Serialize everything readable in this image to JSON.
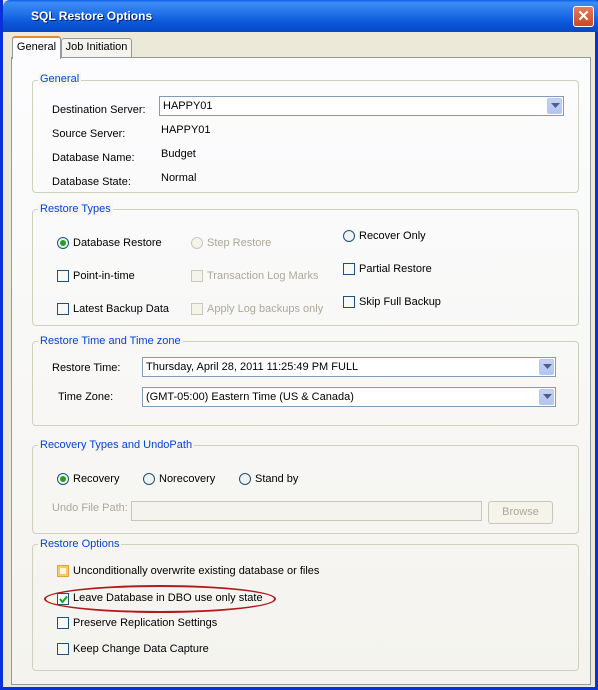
{
  "window": {
    "title": "SQL Restore Options"
  },
  "tabs": [
    {
      "label": "General"
    },
    {
      "label": "Job Initiation"
    }
  ],
  "general": {
    "legend": "General",
    "destination_label": "Destination Server:",
    "destination_value": "HAPPY01",
    "source_label": "Source Server:",
    "source_value": "HAPPY01",
    "dbname_label": "Database Name:",
    "dbname_value": "Budget",
    "dbstate_label": "Database State:",
    "dbstate_value": "Normal"
  },
  "restore_types": {
    "legend": "Restore Types",
    "database_restore": "Database Restore",
    "step_restore": "Step Restore",
    "recover_only": "Recover Only",
    "point_in_time": "Point-in-time",
    "transaction_log_marks": "Transaction Log Marks",
    "partial_restore": "Partial Restore",
    "latest_backup_data": "Latest Backup Data",
    "apply_log_backups_only": "Apply Log backups only",
    "skip_full_backup": "Skip Full Backup"
  },
  "restore_time": {
    "legend": "Restore Time and Time zone",
    "time_label": "Restore Time:",
    "time_value": "Thursday, April 28, 2011 11:25:49 PM FULL",
    "zone_label": "Time Zone:",
    "zone_value": "(GMT-05:00) Eastern Time (US & Canada)"
  },
  "recovery": {
    "legend": "Recovery Types and UndoPath",
    "recovery": "Recovery",
    "norecovery": "Norecovery",
    "standby": "Stand by",
    "undo_label": "Undo File Path:",
    "undo_value": "",
    "browse": "Browse"
  },
  "restore_options": {
    "legend": "Restore Options",
    "overwrite": "Unconditionally overwrite existing database or files",
    "leave_dbo": "Leave Database in DBO use only state",
    "preserve_replication": "Preserve Replication Settings",
    "keep_cdc": "Keep Change Data Capture"
  },
  "colors": {
    "titlebar": "#0a58d8",
    "legend": "#0046d5",
    "highlight": "#b01a1a"
  }
}
